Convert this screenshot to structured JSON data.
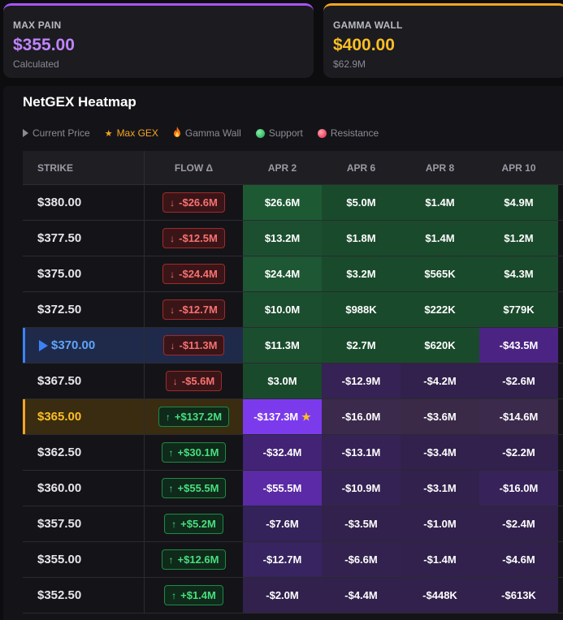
{
  "cards": {
    "max_pain": {
      "label": "MAX PAIN",
      "value": "$355.00",
      "sub": "Calculated"
    },
    "gamma_wall": {
      "label": "GAMMA WALL",
      "value": "$400.00",
      "sub": "$62.9M"
    }
  },
  "heatmap": {
    "title": "NetGEX Heatmap",
    "legend": {
      "current_price": "Current Price",
      "max_gex": "Max GEX",
      "gamma_wall": "Gamma Wall",
      "support": "Support",
      "resistance": "Resistance"
    },
    "columns": {
      "strike": "STRIKE",
      "flow": "FLOW Δ",
      "dates": [
        "APR 2",
        "APR 6",
        "APR 8",
        "APR 10"
      ]
    },
    "rows": [
      {
        "strike": "$380.00",
        "flow": "-$26.6M",
        "flow_dir": "down",
        "cells": [
          "$26.6M",
          "$5.0M",
          "$1.4M",
          "$4.9M"
        ],
        "colors": [
          "#1d5a34",
          "#1a4a2c",
          "#1a4a2c",
          "#1a4a2c"
        ]
      },
      {
        "strike": "$377.50",
        "flow": "-$12.5M",
        "flow_dir": "down",
        "cells": [
          "$13.2M",
          "$1.8M",
          "$1.4M",
          "$1.2M"
        ],
        "colors": [
          "#1b4f30",
          "#1a4a2c",
          "#1a4a2c",
          "#1a4a2c"
        ]
      },
      {
        "strike": "$375.00",
        "flow": "-$24.4M",
        "flow_dir": "down",
        "cells": [
          "$24.4M",
          "$3.2M",
          "$565K",
          "$4.3M"
        ],
        "colors": [
          "#1d5733",
          "#1a4a2c",
          "#1a4a2c",
          "#1a4a2c"
        ]
      },
      {
        "strike": "$372.50",
        "flow": "-$12.7M",
        "flow_dir": "down",
        "cells": [
          "$10.0M",
          "$988K",
          "$222K",
          "$779K"
        ],
        "colors": [
          "#1b4d2f",
          "#1a4a2c",
          "#1a4a2c",
          "#1a4a2c"
        ]
      },
      {
        "strike": "$370.00",
        "flow": "-$11.3M",
        "flow_dir": "down",
        "highlight": "current",
        "cells": [
          "$11.3M",
          "$2.7M",
          "$620K",
          "-$43.5M"
        ],
        "colors": [
          "#1b4d2f",
          "#1a4a2c",
          "#1a4a2c",
          "#4b2483"
        ]
      },
      {
        "strike": "$367.50",
        "flow": "-$5.6M",
        "flow_dir": "down",
        "cells": [
          "$3.0M",
          "-$12.9M",
          "-$4.2M",
          "-$2.6M"
        ],
        "colors": [
          "#1a4a2c",
          "#362255",
          "#31214c",
          "#31214c"
        ]
      },
      {
        "strike": "$365.00",
        "flow": "+$137.2M",
        "flow_dir": "up",
        "highlight": "maxgex",
        "cells": [
          "-$137.3M",
          "-$16.0M",
          "-$3.6M",
          "-$14.6M"
        ],
        "colors": [
          "#7c3aed",
          "#3b2a4c",
          "#3a2a48",
          "#3b2a4c"
        ],
        "star_col": 0
      },
      {
        "strike": "$362.50",
        "flow": "+$30.1M",
        "flow_dir": "up",
        "cells": [
          "-$32.4M",
          "-$13.1M",
          "-$3.4M",
          "-$2.2M"
        ],
        "colors": [
          "#432375",
          "#362255",
          "#31214c",
          "#31214c"
        ]
      },
      {
        "strike": "$360.00",
        "flow": "+$55.5M",
        "flow_dir": "up",
        "cells": [
          "-$55.5M",
          "-$10.9M",
          "-$3.1M",
          "-$16.0M"
        ],
        "colors": [
          "#5b2aa6",
          "#352254",
          "#31214c",
          "#37235a"
        ]
      },
      {
        "strike": "$357.50",
        "flow": "+$5.2M",
        "flow_dir": "up",
        "cells": [
          "-$7.6M",
          "-$3.5M",
          "-$1.0M",
          "-$2.4M"
        ],
        "colors": [
          "#34225a",
          "#31214c",
          "#31214c",
          "#31214c"
        ]
      },
      {
        "strike": "$355.00",
        "flow": "+$12.6M",
        "flow_dir": "up",
        "cells": [
          "-$12.7M",
          "-$6.6M",
          "-$1.4M",
          "-$4.6M"
        ],
        "colors": [
          "#382460",
          "#33224f",
          "#31214c",
          "#31214c"
        ]
      },
      {
        "strike": "$352.50",
        "flow": "+$1.4M",
        "flow_dir": "up",
        "cells": [
          "-$2.0M",
          "-$4.4M",
          "-$448K",
          "-$613K"
        ],
        "colors": [
          "#31214c",
          "#31214c",
          "#31214c",
          "#31214c"
        ]
      }
    ]
  }
}
